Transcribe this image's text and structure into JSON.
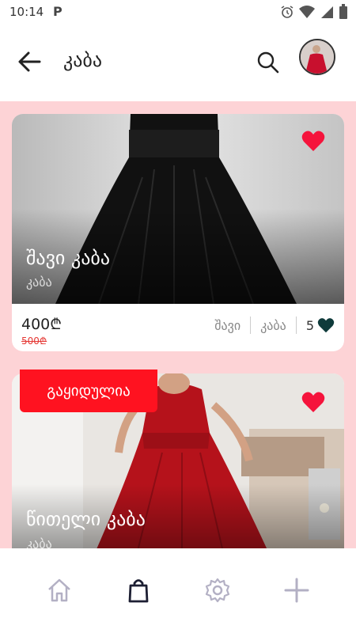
{
  "status_bar": {
    "time": "10:14",
    "app_icon": "parking-p-icon",
    "icons": [
      "alarm-icon",
      "wifi-icon",
      "signal-icon",
      "battery-icon"
    ]
  },
  "header": {
    "title": "კაბა",
    "back_icon": "arrow-left-icon",
    "search_icon": "search-icon",
    "avatar_icon": "avatar"
  },
  "products": [
    {
      "name": "შავი კაბა",
      "category": "კაბა",
      "price": "400₾",
      "old_price": "500₾",
      "tags": [
        "შავი",
        "კაბა"
      ],
      "likes": "5",
      "favorited": true,
      "color": "#1a1a1a"
    },
    {
      "name": "წითელი კაბა",
      "category": "კაბა",
      "sale_label": "გაყიდულია",
      "favorited": true,
      "color": "#b5121b"
    }
  ],
  "nav": {
    "items": [
      "home-icon",
      "shopping-bag-icon",
      "settings-icon",
      "add-icon"
    ],
    "active": "shopping-bag-icon"
  },
  "colors": {
    "accent_red": "#ff1220",
    "background_pink": "#fdd3d6",
    "heart_red": "#f5143c",
    "heart_dark": "#0f3b3b"
  }
}
